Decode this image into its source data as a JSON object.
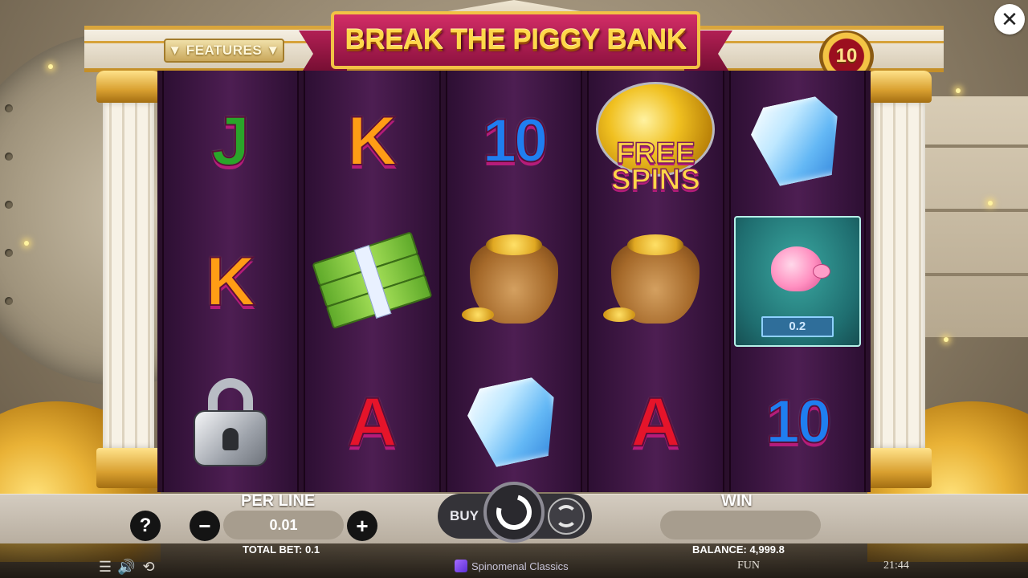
{
  "game": {
    "title": "BREAK THE PIGGY BANK",
    "features_label": "▼ FEATURES ▼",
    "lines_count": "10"
  },
  "reels": [
    [
      {
        "type": "letter",
        "symbol": "J"
      },
      {
        "type": "letter",
        "symbol": "K"
      },
      {
        "type": "lock",
        "symbol": "padlock"
      }
    ],
    [
      {
        "type": "letter",
        "symbol": "K"
      },
      {
        "type": "cash",
        "symbol": "cash-stack"
      },
      {
        "type": "letter",
        "symbol": "A"
      }
    ],
    [
      {
        "type": "letter",
        "symbol": "10"
      },
      {
        "type": "bag",
        "symbol": "gold-bag"
      },
      {
        "type": "diamond",
        "symbol": "diamond"
      }
    ],
    [
      {
        "type": "freespins",
        "symbol": "FREE SPINS"
      },
      {
        "type": "bag",
        "symbol": "gold-bag"
      },
      {
        "type": "letter",
        "symbol": "A"
      }
    ],
    [
      {
        "type": "diamond",
        "symbol": "diamond"
      },
      {
        "type": "bonus",
        "symbol": "piggy-bonus",
        "value": "0.2"
      },
      {
        "type": "letter",
        "symbol": "10"
      }
    ]
  ],
  "controls": {
    "help_label": "?",
    "per_line_label": "PER LINE",
    "per_line_value": "0.01",
    "minus_label": "−",
    "plus_label": "+",
    "buy_label": "BUY",
    "win_label": "WIN",
    "win_value": "",
    "total_bet": "TOTAL BET: 0.1",
    "balance": "BALANCE: 4,999.8"
  },
  "status": {
    "provider": "Spinomenal Classics",
    "mode": "FUN",
    "time": "21:44",
    "icons": [
      "menu-icon",
      "sound-icon",
      "turbo-icon"
    ]
  },
  "close_label": "✕"
}
